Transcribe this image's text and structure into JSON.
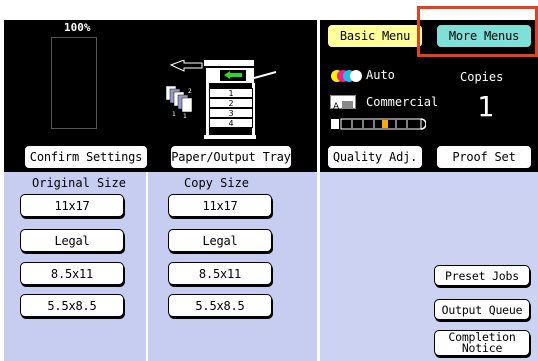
{
  "preview": {
    "zoom": "100%"
  },
  "left_buttons": {
    "confirm_settings": "Confirm Settings",
    "paper_output_tray": "Paper/Output Tray"
  },
  "trays": [
    "1",
    "2",
    "3",
    "4"
  ],
  "original_size": {
    "heading": "Original Size",
    "options": [
      "11x17",
      "Legal",
      "8.5x11",
      "5.5x8.5"
    ]
  },
  "copy_size": {
    "heading": "Copy Size",
    "options": [
      "11x17",
      "Legal",
      "8.5x11",
      "5.5x8.5"
    ]
  },
  "header_tabs": {
    "basic_menu": "Basic Menu",
    "more_menus": "More Menus"
  },
  "status": {
    "color_mode": "Auto",
    "copies_label": "Copies",
    "copies_value": "1",
    "quality_mode": "Commercial",
    "density_level": 0.55
  },
  "quality_buttons": {
    "quality_adj": "Quality Adj.",
    "proof_set": "Proof Set"
  },
  "right_buttons": {
    "preset_jobs": "Preset Jobs",
    "output_queue": "Output Queue",
    "completion_notice": [
      "Completion",
      "Notice"
    ]
  },
  "colors": {
    "panel_bg": "#000000",
    "lower_bg": "#c7cdf0",
    "right_bg": "#ccd2f2",
    "basic_menu": "#ffff99",
    "more_menus": "#7ee0d8",
    "highlight": "#e8401c"
  }
}
